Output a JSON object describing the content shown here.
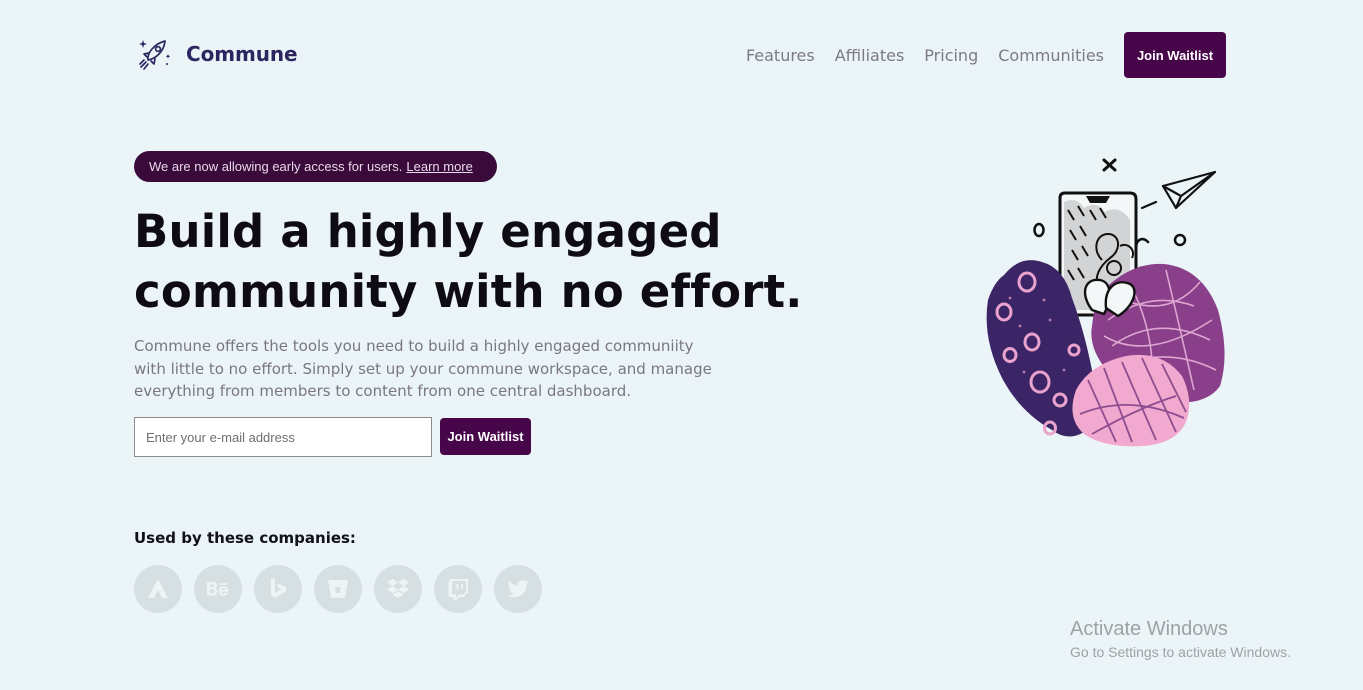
{
  "header": {
    "brand_name": "Commune",
    "logo_icon": "rocket-icon",
    "nav": [
      {
        "label": "Features"
      },
      {
        "label": "Affiliates"
      },
      {
        "label": "Pricing"
      },
      {
        "label": "Communities"
      }
    ],
    "cta_label": "Join Waitlist"
  },
  "hero": {
    "announcement_text": "We are now allowing early access for users.",
    "announcement_link": "Learn more",
    "headline_line1": "Build a highly engaged",
    "headline_line2": "community with no effort.",
    "description": "Commune offers the tools you need to build a highly engaged communiity with little to no effort. Simply set up your commune workspace, and manage everything from members to content from one central dashboard.",
    "email_placeholder": "Enter your e-mail address",
    "email_value": "",
    "join_label": "Join Waitlist",
    "illustration": "phone-paper-plane-illustration"
  },
  "companies": {
    "title": "Used by these companies:",
    "logos": [
      "atlassian-icon",
      "behance-icon",
      "bing-icon",
      "bitbucket-icon",
      "dropbox-icon",
      "twitch-icon",
      "twitter-icon"
    ]
  },
  "os_watermark": {
    "title": "Activate Windows",
    "subtitle": "Go to Settings to activate Windows."
  },
  "colors": {
    "background": "#ebf5f7",
    "primary": "#47054a",
    "announcement_bg": "#3a0a3a",
    "brand_text": "#2c2560",
    "muted_text": "#7b7781",
    "logo_circle": "#d6dfe2",
    "logo_glyph": "#eef4f6"
  }
}
